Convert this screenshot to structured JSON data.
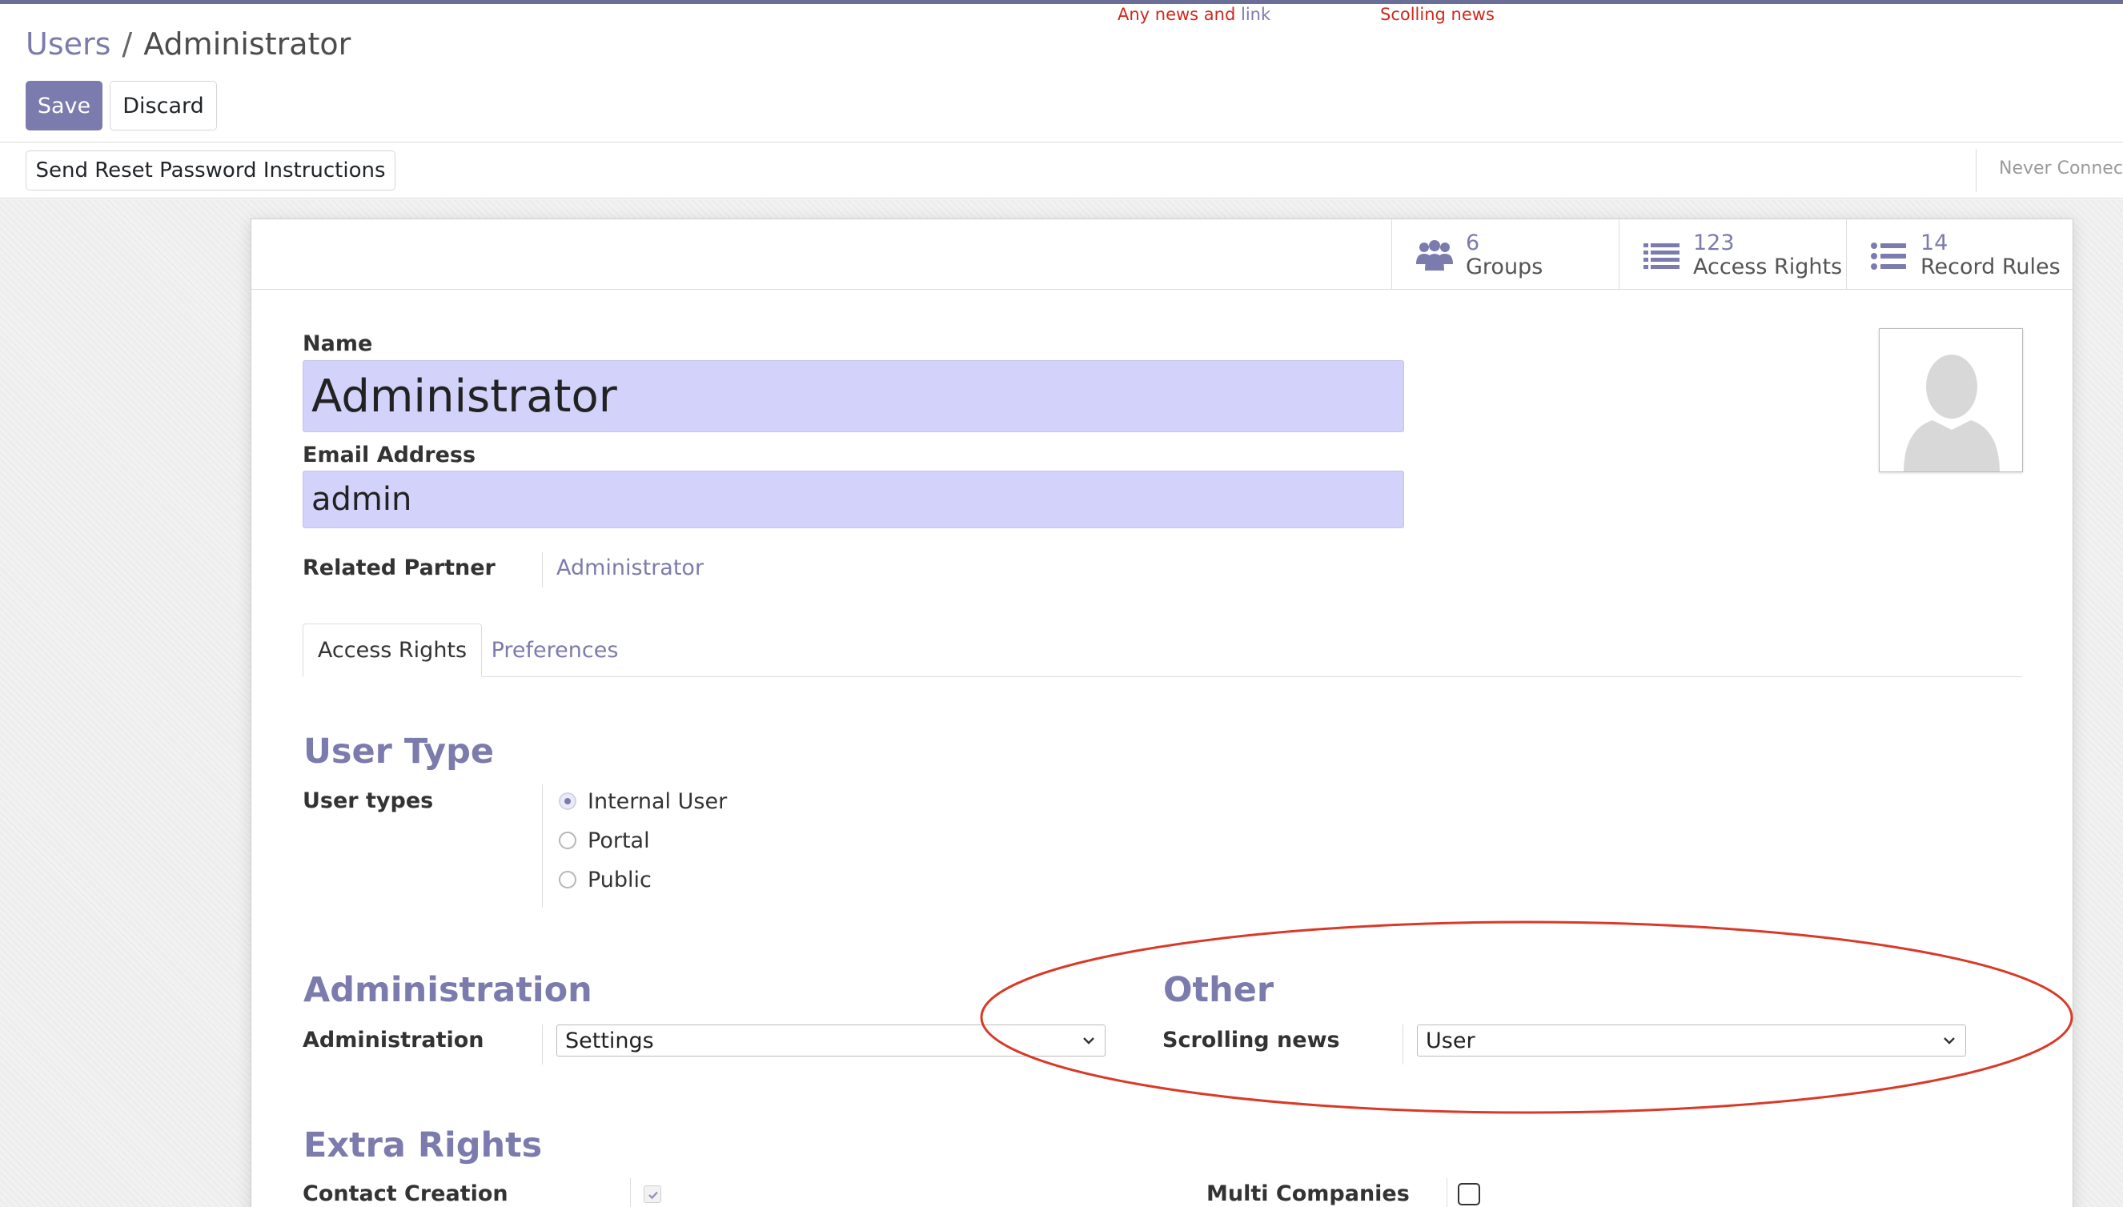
{
  "banner": {
    "news_prefix": "Any news and",
    "news_link": "link",
    "scrolling": "Scolling news"
  },
  "breadcrumb": {
    "parent": "Users",
    "separator": "/",
    "current": "Administrator"
  },
  "actions": {
    "save": "Save",
    "discard": "Discard"
  },
  "statusbar": {
    "reset_button": "Send Reset Password Instructions",
    "status_text": "Never Connec"
  },
  "smart_buttons": [
    {
      "count": "6",
      "label": "Groups",
      "icon": "users-icon"
    },
    {
      "count": "123",
      "label": "Access Rights",
      "icon": "list-icon"
    },
    {
      "count": "14",
      "label": "Record Rules",
      "icon": "list-bullets-icon"
    }
  ],
  "form": {
    "name_label": "Name",
    "name_value": "Administrator",
    "email_label": "Email Address",
    "email_value": "admin",
    "partner_label": "Related Partner",
    "partner_value": "Administrator"
  },
  "tabs": [
    {
      "label": "Access Rights",
      "active": true
    },
    {
      "label": "Preferences",
      "active": false
    }
  ],
  "user_type": {
    "title": "User Type",
    "label": "User types",
    "options": [
      {
        "label": "Internal User",
        "checked": true
      },
      {
        "label": "Portal",
        "checked": false
      },
      {
        "label": "Public",
        "checked": false
      }
    ]
  },
  "administration": {
    "title": "Administration",
    "label": "Administration",
    "value": "Settings"
  },
  "other": {
    "title": "Other",
    "label": "Scrolling news",
    "value": "User"
  },
  "extra_rights": {
    "title": "Extra Rights",
    "contact_creation_label": "Contact Creation",
    "contact_creation_checked": true,
    "multi_companies_label": "Multi Companies",
    "multi_companies_checked": false
  },
  "colors": {
    "brand": "#7c7bad",
    "highlight_input": "#d2d2fa",
    "annotation": "#d93a28"
  }
}
